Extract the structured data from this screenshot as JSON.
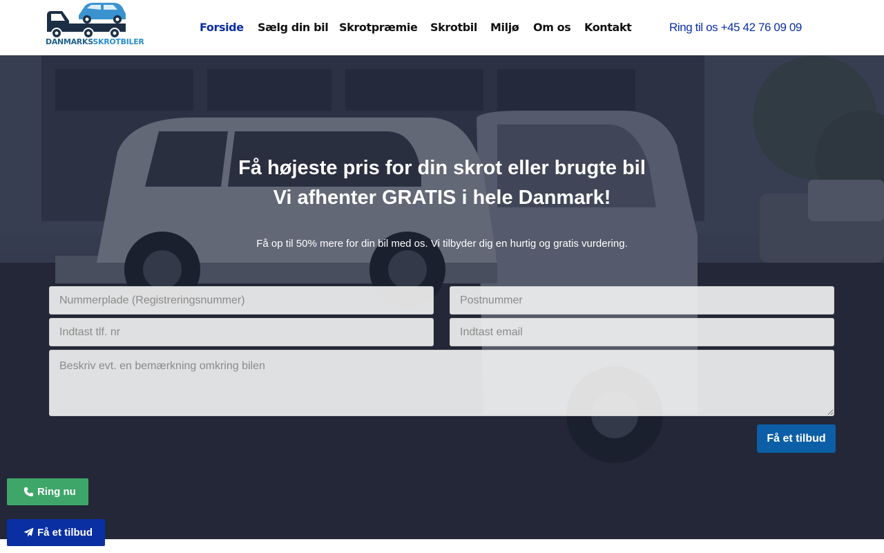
{
  "header": {
    "logo_text_a": "DANMARKS",
    "logo_text_b": "SKROTBILER",
    "nav": [
      {
        "label": "Forside",
        "active": true
      },
      {
        "label": "Sælg din bil"
      },
      {
        "label": "Skrotpræmie"
      },
      {
        "label": "Skrotbil"
      },
      {
        "label": "Miljø"
      },
      {
        "label": "Om os"
      },
      {
        "label": "Kontakt"
      }
    ],
    "phone_label": "Ring til os +45 42 76 09 09"
  },
  "hero": {
    "title_line1": "Få højeste pris for din skrot eller brugte bil",
    "title_line2": "Vi afhenter GRATIS i hele Danmark!",
    "subtitle": "Få op til 50% mere for din bil med os. Vi tilbyder dig en hurtig og gratis vurdering.",
    "form": {
      "plate_placeholder": "Nummerplade (Registreringsnummer)",
      "zip_placeholder": "Postnummer",
      "phone_placeholder": "Indtast tlf. nr",
      "email_placeholder": "Indtast email",
      "note_placeholder": "Beskriv evt. en bemærkning omkring bilen",
      "submit_label": "Få et tilbud"
    }
  },
  "floating": {
    "call_label": "Ring nu",
    "quote_label": "Få et tilbud"
  },
  "colors": {
    "brand_blue": "#0a2fa3",
    "button_blue": "#0c5fa6",
    "call_green": "#3fa66a"
  }
}
